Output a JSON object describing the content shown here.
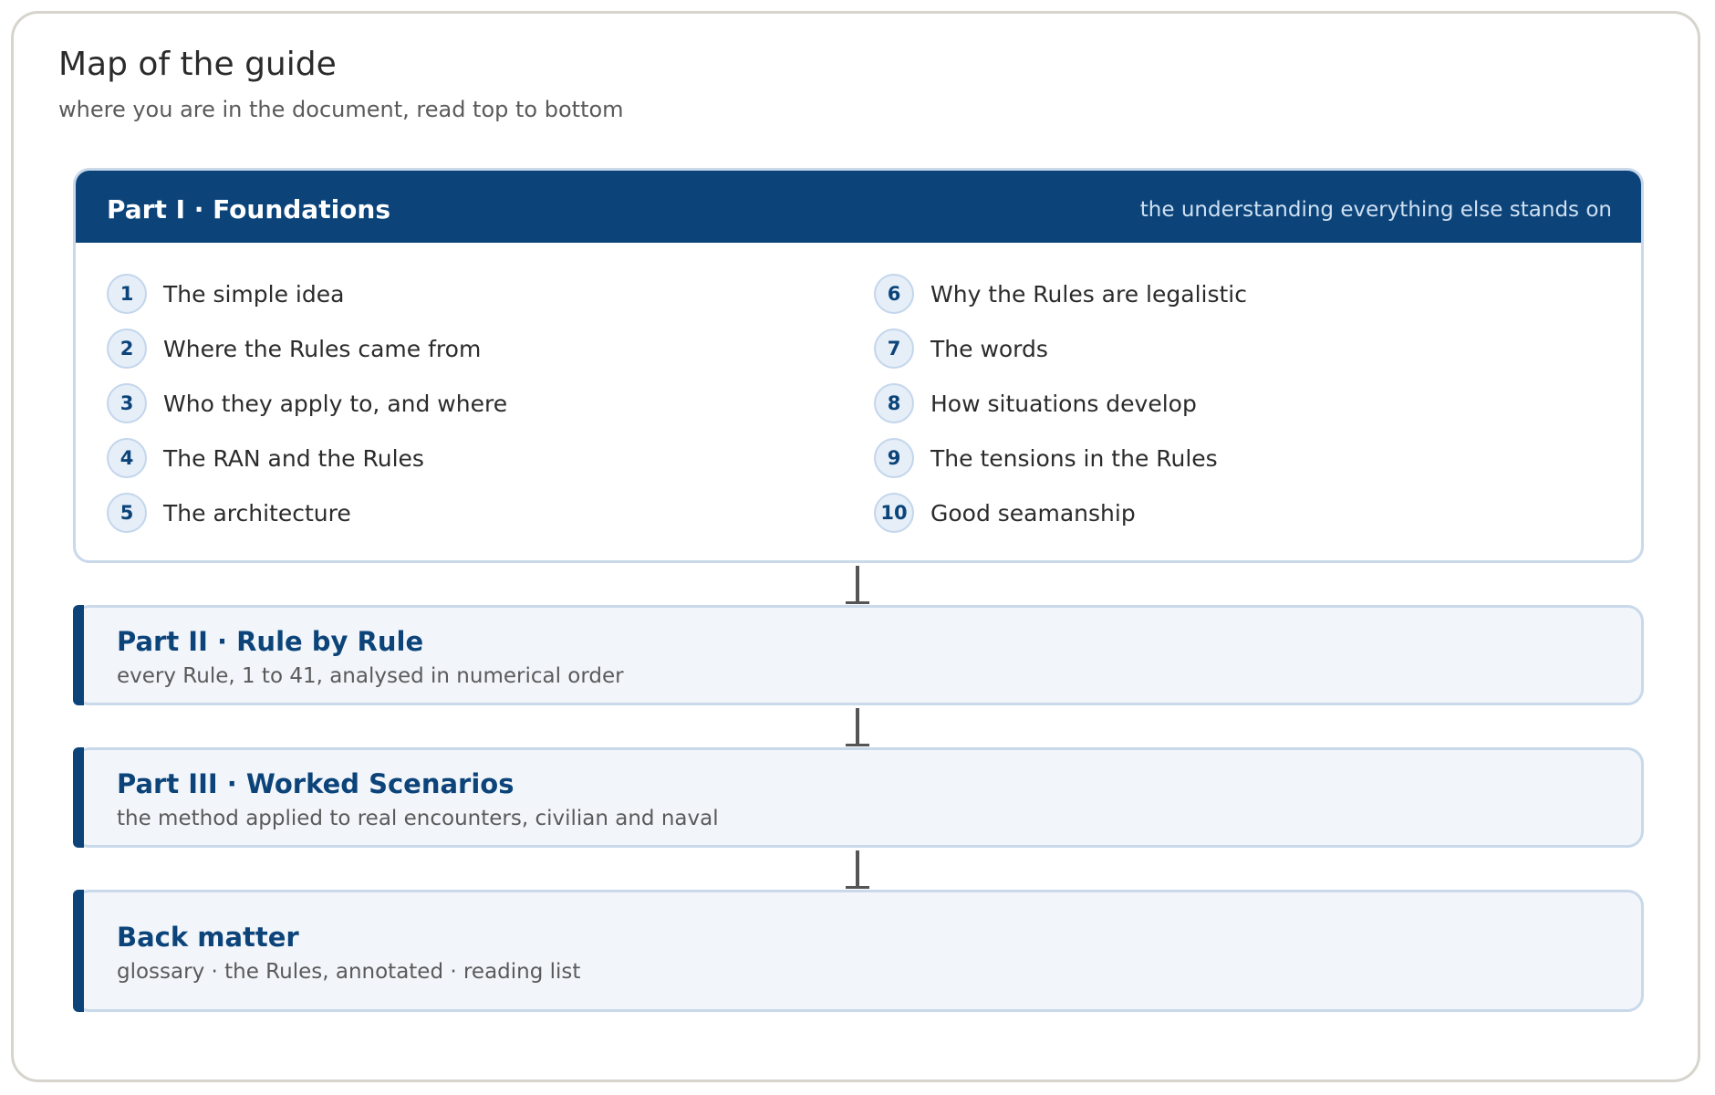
{
  "title": "Map of the guide",
  "subtitle": "where you are in the document, read top to bottom",
  "colors": {
    "primary": "#0c447a",
    "panel": "#f2f6fb",
    "border": "#c9d9ea",
    "frame": "#d6d4cc"
  },
  "part1": {
    "title": "Part I · Foundations",
    "tagline": "the understanding everything else stands on",
    "chapters": [
      {
        "num": "1",
        "label": "The simple idea"
      },
      {
        "num": "2",
        "label": "Where the Rules came from"
      },
      {
        "num": "3",
        "label": "Who they apply to, and where"
      },
      {
        "num": "4",
        "label": "The RAN and the Rules"
      },
      {
        "num": "5",
        "label": "The architecture"
      },
      {
        "num": "6",
        "label": "Why the Rules are legalistic"
      },
      {
        "num": "7",
        "label": "The words"
      },
      {
        "num": "8",
        "label": "How situations develop"
      },
      {
        "num": "9",
        "label": "The tensions in the Rules"
      },
      {
        "num": "10",
        "label": "Good seamanship"
      }
    ]
  },
  "parts": [
    {
      "title": "Part II · Rule by Rule",
      "desc": "every Rule, 1 to 41, analysed in numerical order"
    },
    {
      "title": "Part III · Worked Scenarios",
      "desc": "the method applied to real encounters, civilian and naval"
    },
    {
      "title": "Back matter",
      "desc": "glossary · the Rules, annotated · reading list"
    }
  ]
}
